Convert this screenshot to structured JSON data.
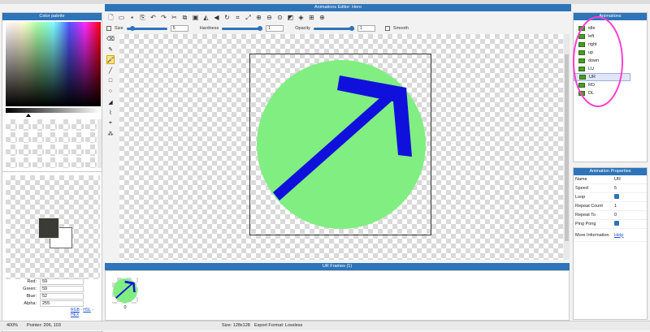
{
  "window": {
    "title": "Animations Editor: Hero"
  },
  "colorPalette": {
    "title": "Color palette"
  },
  "colors": {
    "primary": "#3a3a36",
    "secondary": "#ffffff",
    "accent": "#2d74b8",
    "circle": "#80ee80",
    "arrow": "#1010dd",
    "annotation": "#ff3fd0"
  },
  "rgb": {
    "red_label": "Red:",
    "red": "59",
    "green_label": "Green:",
    "green": "59",
    "blue_label": "Blue:",
    "blue": "52",
    "alpha_label": "Alpha:",
    "alpha": "255",
    "modes": [
      "RGB",
      "HSL",
      "HEX"
    ]
  },
  "toolbar": {
    "size_label": "Size",
    "size_value": "5",
    "hardness_label": "Hardness",
    "hardness_value": "1",
    "opacity_label": "Opacity",
    "opacity_value": "1",
    "smooth_label": "Smooth",
    "size_level": 0.1,
    "hardness_level": 1.0,
    "opacity_level": 1.0
  },
  "frames": {
    "title": "UR Frames (1)",
    "items": [
      {
        "index": "0"
      }
    ]
  },
  "animations": {
    "title": "Animations",
    "items": [
      "idle",
      "left",
      "right",
      "up",
      "down",
      "LU",
      "UR",
      "RD",
      "DL"
    ],
    "selected": "UR"
  },
  "properties": {
    "title": "Animation Properties",
    "name_label": "Name",
    "name_value": "UR",
    "speed_label": "Speed",
    "speed_value": "5",
    "loop_label": "Loop",
    "repeat_count_label": "Repeat Count",
    "repeat_count_value": "1",
    "repeat_to_label": "Repeat To",
    "repeat_to_value": "0",
    "ping_pong_label": "Ping Pong",
    "more_info_label": "More Information",
    "more_info_link": "Help"
  },
  "status": {
    "zoom": "400%",
    "pointer": "Pointer: 206, 103",
    "size": "Size: 128x128",
    "export": "Export Format: Lossless"
  },
  "icons": [
    "new-file-icon",
    "open-folder-icon",
    "save-icon",
    "export-icon",
    "undo-icon",
    "redo-icon",
    "cut-icon",
    "copy-icon",
    "paste-icon",
    "flip-icon",
    "rotate-icon",
    "crop-icon",
    "zoom-in-icon",
    "zoom-out-icon",
    "zoom-fit-icon",
    "layers-icon",
    "grid-icon",
    "add-icon",
    "eraser-icon",
    "pencil-icon",
    "brush-icon",
    "line-icon",
    "rect-icon",
    "ellipse-icon",
    "fill-icon",
    "picker-icon",
    "select-icon"
  ]
}
